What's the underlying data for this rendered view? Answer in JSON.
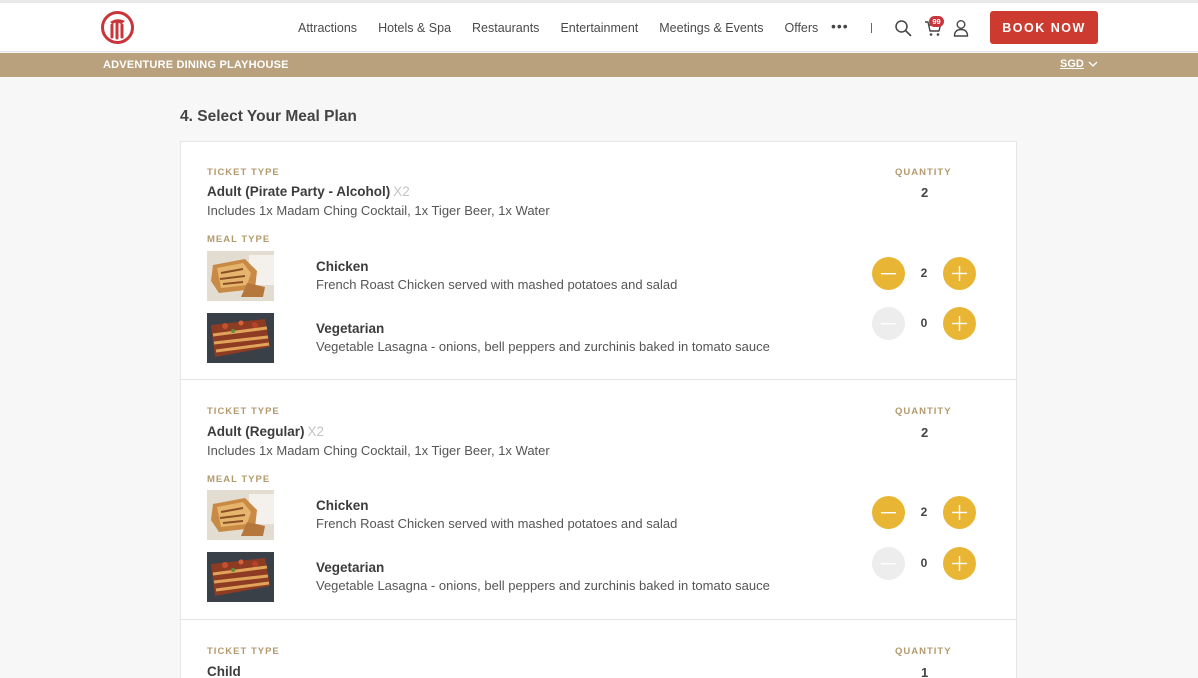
{
  "nav": {
    "links": [
      "Attractions",
      "Hotels & Spa",
      "Restaurants",
      "Entertainment",
      "Meetings & Events",
      "Offers"
    ],
    "more": "•••",
    "cart_count": "99",
    "book_label": "BOOK NOW"
  },
  "subbar": {
    "title": "ADVENTURE DINING PLAYHOUSE",
    "currency": "SGD"
  },
  "section_title": "4. Select Your Meal Plan",
  "labels": {
    "ticket_type": "TICKET TYPE",
    "quantity": "QUANTITY",
    "meal_type": "MEAL TYPE"
  },
  "tickets": [
    {
      "name": "Adult  (Pirate Party - Alcohol)",
      "multiplier": "X2",
      "desc": "Includes 1x Madam Ching Cocktail, 1x Tiger Beer, 1x Water",
      "quantity": "2",
      "meals": [
        {
          "name": "Chicken",
          "desc": "French Roast Chicken served with mashed potatoes and salad",
          "count": "2"
        },
        {
          "name": "Vegetarian",
          "desc": "Vegetable Lasagna - onions, bell peppers and zurchinis baked in tomato sauce",
          "count": "0"
        }
      ]
    },
    {
      "name": "Adult  (Regular)",
      "multiplier": "X2",
      "desc": "Includes 1x Madam Ching Cocktail, 1x Tiger Beer, 1x Water",
      "quantity": "2",
      "meals": [
        {
          "name": "Chicken",
          "desc": "French Roast Chicken served with mashed potatoes and salad",
          "count": "2"
        },
        {
          "name": "Vegetarian",
          "desc": "Vegetable Lasagna - onions, bell peppers and zurchinis baked in tomato sauce",
          "count": "0"
        }
      ]
    },
    {
      "name": "Child",
      "quantity": "1"
    }
  ],
  "colors": {
    "accent": "#e9b534",
    "brand_red": "#cd3b30",
    "gold_label": "#b39a6e",
    "subbar": "#b9a17e"
  }
}
